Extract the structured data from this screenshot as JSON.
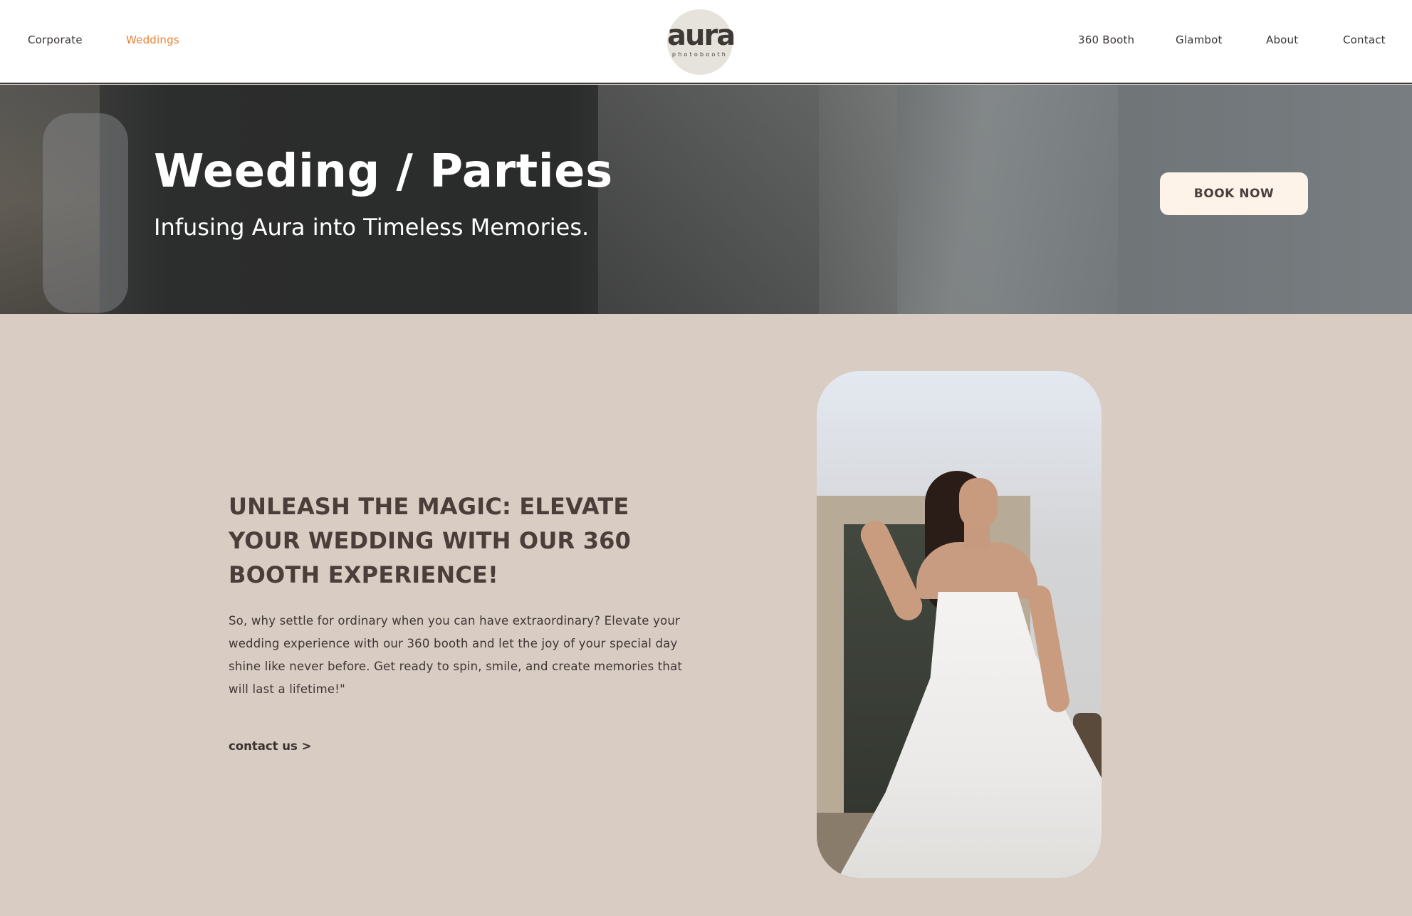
{
  "header": {
    "nav_left": [
      {
        "label": "Corporate",
        "active": false
      },
      {
        "label": "Weddings",
        "active": true
      }
    ],
    "logo": {
      "word": "aura",
      "sub": "photobooth"
    },
    "nav_right": [
      {
        "label": "360 Booth"
      },
      {
        "label": "Glambot"
      },
      {
        "label": "About"
      },
      {
        "label": "Contact"
      }
    ],
    "active_color": "#ee7e2f"
  },
  "hero": {
    "title": "Weeding / Parties",
    "subtitle": "Infusing Aura into Timeless Memories.",
    "cta_label": "BOOK NOW"
  },
  "content": {
    "heading": "UNLEASH THE MAGIC: ELEVATE YOUR WEDDING WITH OUR 360 BOOTH EXPERIENCE!",
    "body": "So, why settle for ordinary when you can have extraordinary? Elevate your wedding experience with our 360 booth and let the joy of your special day shine like never before. Get ready to spin, smile, and create memories that will last a lifetime!\"",
    "link_label": "contact us >"
  },
  "colors": {
    "content_background": "#d8ccc3",
    "heading_text": "#4b3e3a",
    "cta_background": "#fdf3e8"
  }
}
